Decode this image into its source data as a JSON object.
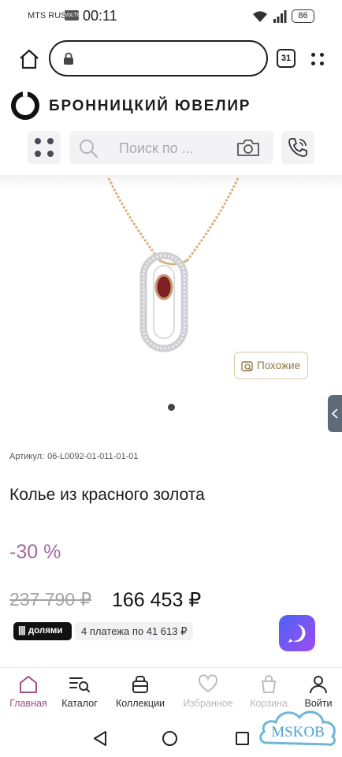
{
  "status_bar": {
    "carrier": "MTS RUS",
    "volte": "VoLTE",
    "time": "00:11",
    "battery": "86"
  },
  "browser": {
    "url": "",
    "tab_count": "31",
    "icons": [
      "home-icon",
      "lock-icon",
      "tabs-icon",
      "more-vertical-icon"
    ]
  },
  "header": {
    "brand": "БРОННИЦКИЙ ЮВЕЛИР",
    "search_placeholder": "Поиск по ..."
  },
  "gallery": {
    "similar_label": "Похожие",
    "slide_count": 1,
    "active_slide": 1
  },
  "product": {
    "sku_label": "Артикул:",
    "sku_value": "06-L0092-01-011-01-01",
    "title": "Колье из красного золота",
    "discount": "-30 %",
    "old_price": "237 790 ₽",
    "new_price": "166 453 ₽",
    "dolyami_label": "долями",
    "installment_text": "4 платежа по 41 613 ₽"
  },
  "bottom_nav": {
    "items": [
      {
        "label": "Главная",
        "icon": "home-icon",
        "state": "active"
      },
      {
        "label": "Каталог",
        "icon": "catalog-search-icon",
        "state": "normal"
      },
      {
        "label": "Коллекции",
        "icon": "collections-icon",
        "state": "normal"
      },
      {
        "label": "Избранное",
        "icon": "heart-icon",
        "state": "disabled"
      },
      {
        "label": "Корзина",
        "icon": "cart-icon",
        "state": "disabled"
      },
      {
        "label": "Войти",
        "icon": "user-icon",
        "state": "normal"
      }
    ]
  },
  "watermark": {
    "text": "MSKOB"
  },
  "colors": {
    "accent": "#a34d83",
    "discount": "#a36aa1",
    "gold_border": "#d8c79e",
    "muted": "#a3a3a3"
  }
}
